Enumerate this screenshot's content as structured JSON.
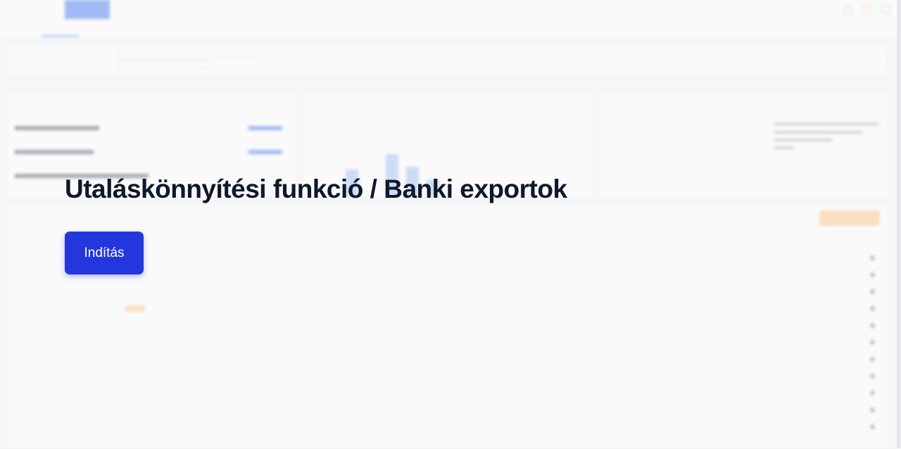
{
  "colors": {
    "accent": "#2337dd",
    "title_text": "#0f172a",
    "highlight_orange": "#fdba74"
  },
  "overlay": {
    "title": "Utaláskönnyítési funkció / Banki exportok",
    "start_button_label": "Indítás"
  }
}
